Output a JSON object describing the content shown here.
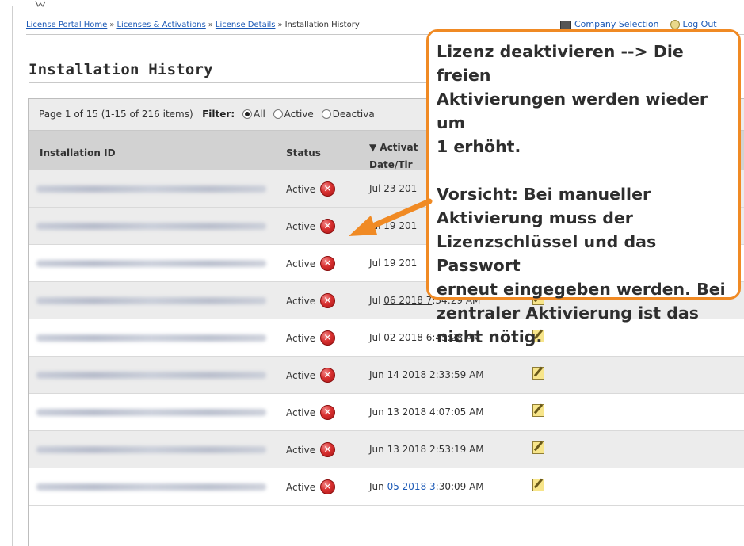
{
  "breadcrumb": {
    "items": [
      "License Portal Home",
      "Licenses & Activations",
      "License Details"
    ],
    "current": "Installation History",
    "separator": "»"
  },
  "topbar": {
    "company": "Company Selection",
    "logout": "Log Out"
  },
  "page": {
    "title": "Installation History"
  },
  "pager": {
    "text": "Page 1 of 15 (1-15 of 216 items)",
    "filter_label": "Filter:",
    "opt_all": "All",
    "opt_active": "Active",
    "opt_deactivated": "Deactiva"
  },
  "table": {
    "headers": {
      "id": "Installation ID",
      "status": "Status",
      "activated_1": "▼ Activat",
      "activated_2": "Date/Tir"
    },
    "rows": [
      {
        "status": "Active",
        "date": "Jul 23 201"
      },
      {
        "status": "Active",
        "date": "Jul 19 201"
      },
      {
        "status": "Active",
        "date": "Jul 19 201"
      },
      {
        "status": "Active",
        "date_pre": "Jul ",
        "date_link": "06 2018 7",
        "date_post": ":34:29 AM",
        "link_blue": false
      },
      {
        "status": "Active",
        "date": "Jul 02 2018 6:45:28 AM"
      },
      {
        "status": "Active",
        "date": "Jun 14 2018 2:33:59 AM"
      },
      {
        "status": "Active",
        "date": "Jun 13 2018 4:07:05 AM"
      },
      {
        "status": "Active",
        "date": "Jun 13 2018 2:53:19 AM"
      },
      {
        "status": "Active",
        "date_pre": "Jun ",
        "date_link": "05 2018 3",
        "date_post": ":30:09 AM",
        "link_blue": true
      }
    ]
  },
  "callout": {
    "line1": "Lizenz deaktivieren --> Die freien",
    "line2": "Aktivierungen werden wieder um",
    "line3": "1 erhöht.",
    "line4": "Vorsicht: Bei manueller",
    "line5": "Aktivierung muss der",
    "line6": "Lizenzschlüssel und das Passwort",
    "line7": "erneut eingegeben werden. Bei",
    "line8": "zentraler Aktivierung  ist das",
    "line9": "nicht nötig."
  },
  "colors": {
    "callout_border": "#f08a24",
    "arrow": "#f08a24",
    "link": "#1a58b5",
    "delete_red": "#d83030"
  },
  "icons": {
    "delete": "delete-x-icon",
    "edit": "edit-note-icon"
  }
}
